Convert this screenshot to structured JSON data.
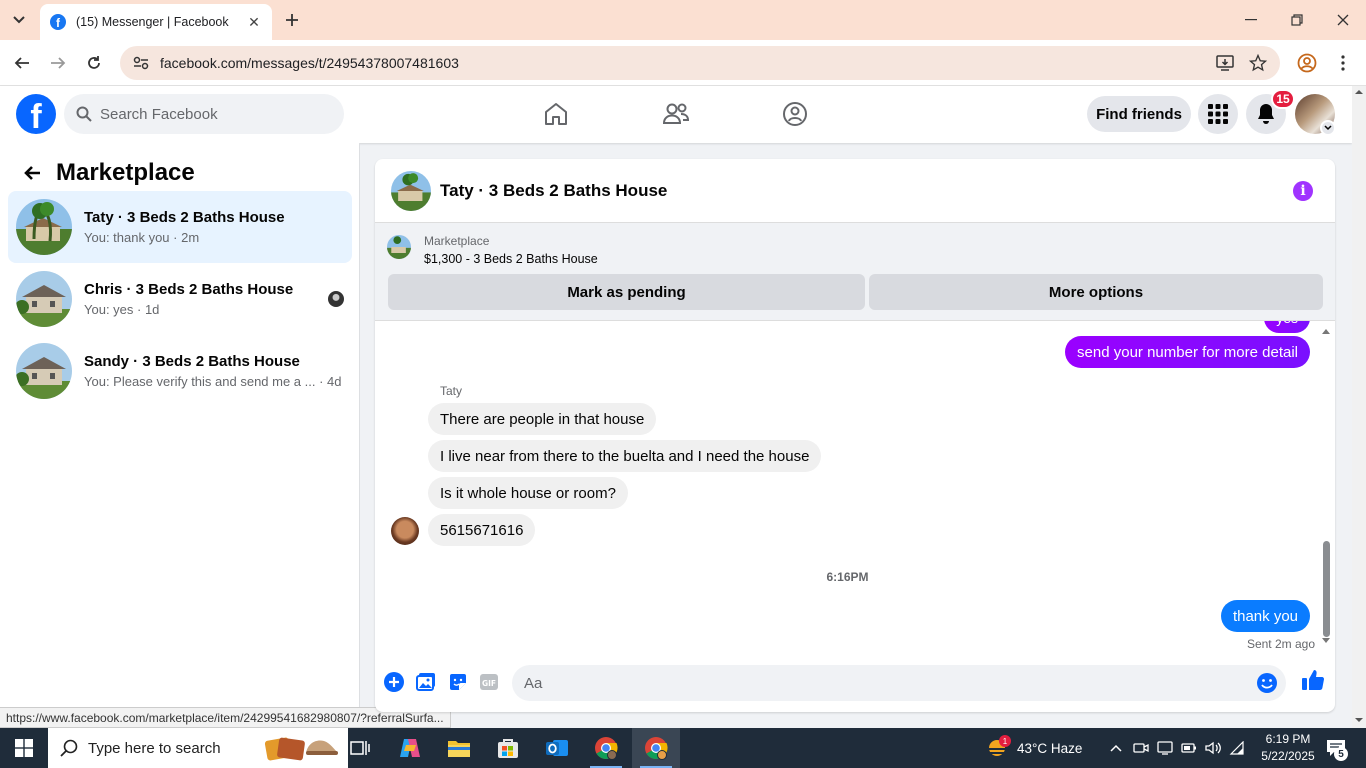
{
  "browser": {
    "tab_title": "(15) Messenger | Facebook",
    "url": "facebook.com/messages/t/24954378007481603",
    "status_url": "https://www.facebook.com/marketplace/item/24299541682980807/?referralSurfa..."
  },
  "fb_header": {
    "search_placeholder": "Search Facebook",
    "find_friends": "Find friends",
    "notification_count": "15"
  },
  "left_panel": {
    "title": "Marketplace",
    "conversations": [
      {
        "name": "Taty · 3 Beds 2 Baths House",
        "last": "You: thank you · 2m"
      },
      {
        "name": "Chris · 3 Beds 2 Baths House",
        "last": "You: yes · 1d"
      },
      {
        "name": "Sandy · 3 Beds 2 Baths House",
        "last": "You: Please verify this and send me a ... · 4d"
      }
    ]
  },
  "chat": {
    "title": "Taty · 3 Beds 2 Baths House",
    "listing_source": "Marketplace",
    "listing_price": "$1,300 - 3 Beds 2 Baths House",
    "mark_pending": "Mark as pending",
    "more_options": "More options",
    "partial_top": "yes",
    "msg_out_1": "send your number for more detail",
    "sender": "Taty",
    "msg_in_1": "There are people in that house",
    "msg_in_2": "I live near from there to the buelta and I need the house",
    "msg_in_3": "Is it whole house or room?",
    "msg_in_4": "5615671616",
    "time_separator": "6:16PM",
    "msg_out_2": "thank you",
    "sent_label": "Sent 2m ago",
    "composer_placeholder": "Aa"
  },
  "taskbar": {
    "search_placeholder": "Type here to search",
    "weather": "43°C  Haze",
    "time": "6:19 PM",
    "date": "5/22/2025",
    "notif_count": "5",
    "weather_badge": "1"
  },
  "colors": {
    "fb_blue": "#0866ff",
    "bubble_purple": "#8a06ff",
    "bubble_blue": "#0a7cff",
    "badge_red": "#e41e3f"
  }
}
